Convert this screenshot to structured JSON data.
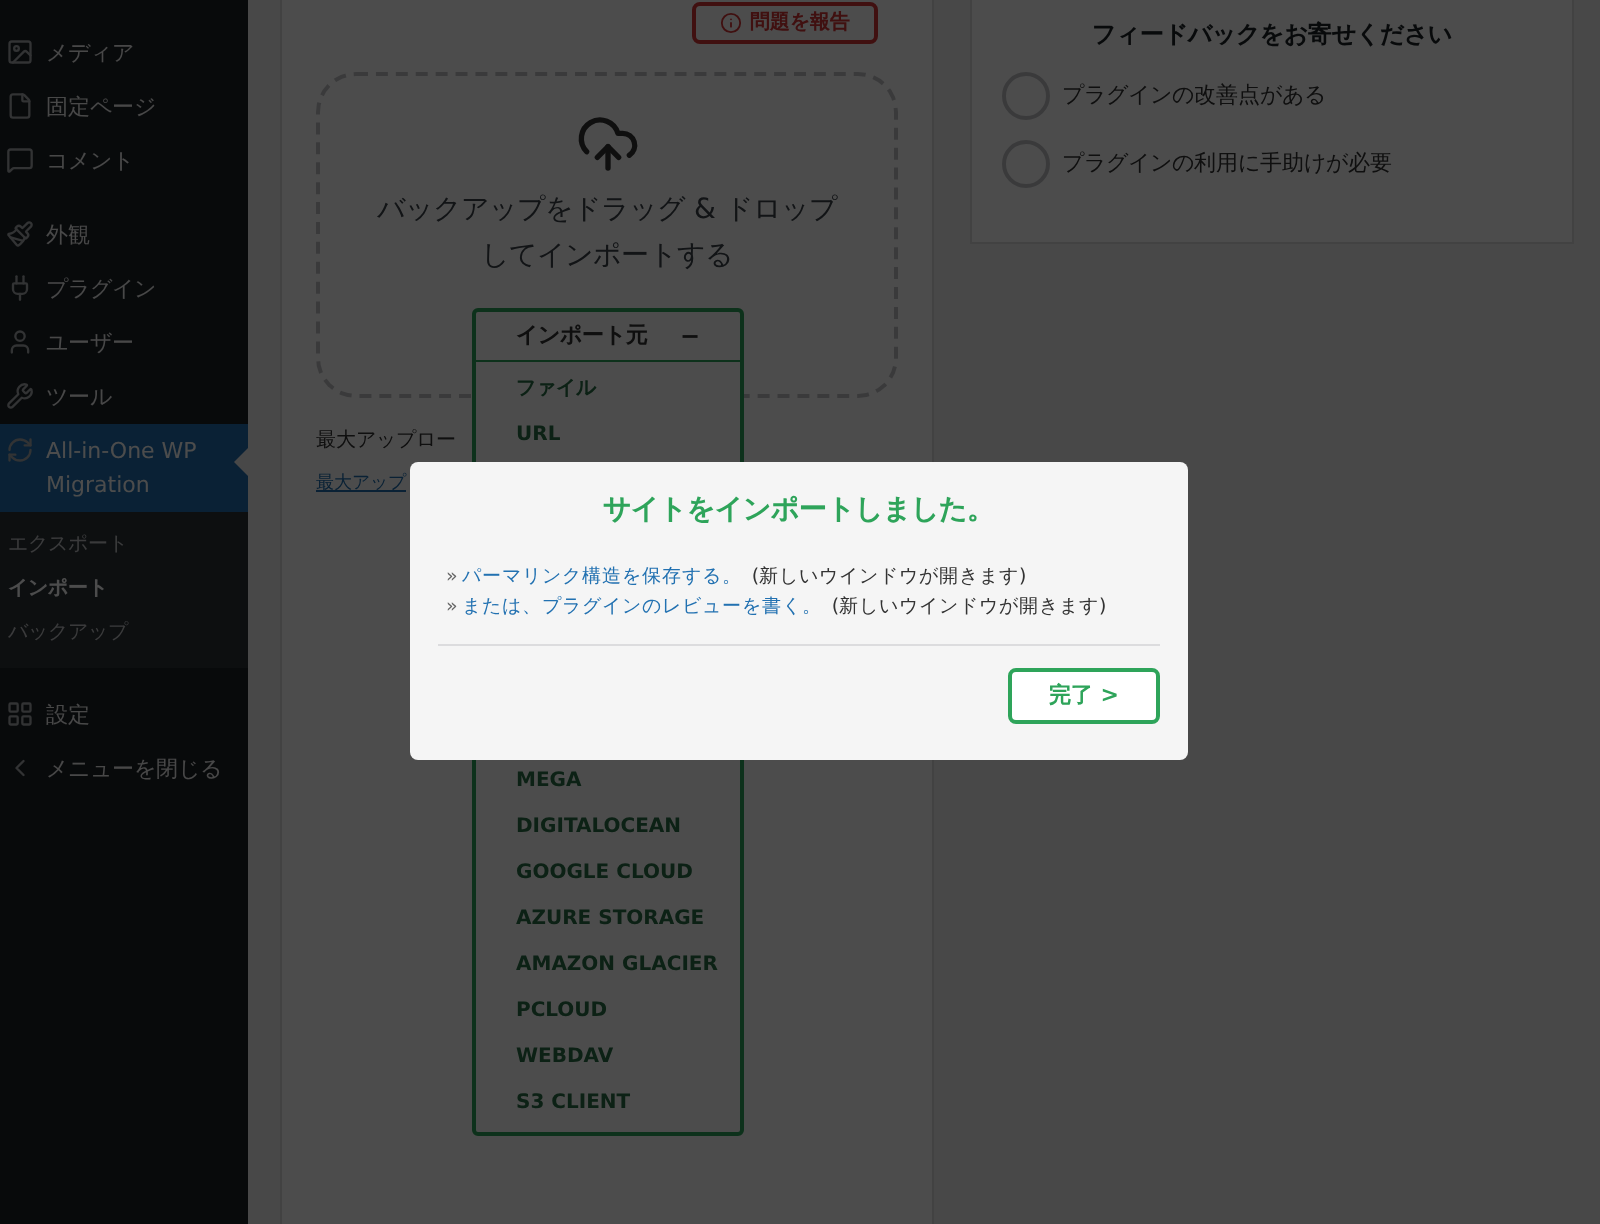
{
  "sidebar": {
    "items": [
      {
        "label": "メディア",
        "selected": false
      },
      {
        "label": "固定ページ",
        "selected": false
      },
      {
        "label": "コメント",
        "selected": false
      },
      {
        "label": "外観",
        "selected": false
      },
      {
        "label": "プラグイン",
        "selected": false
      },
      {
        "label": "ユーザー",
        "selected": false
      },
      {
        "label": "ツール",
        "selected": false
      },
      {
        "label": "All-in-One WP Migration",
        "selected": true,
        "children": [
          {
            "label": "エクスポート",
            "selected": false
          },
          {
            "label": "インポート",
            "selected": true
          },
          {
            "label": "バックアップ",
            "selected": false
          }
        ]
      },
      {
        "label": "設定",
        "selected": false
      },
      {
        "label": "メニューを閉じる",
        "selected": false
      }
    ]
  },
  "report_button": "問題を報告",
  "dropzone": {
    "text": "バックアップをドラッグ & ドロップしてインポートする"
  },
  "import_menu": {
    "title": "インポート元",
    "toggle": "−",
    "items": [
      "ファイル",
      "URL",
      "MEGA",
      "DIGITALOCEAN",
      "GOOGLE CLOUD",
      "AZURE STORAGE",
      "AMAZON GLACIER",
      "PCLOUD",
      "WEBDAV",
      "S3 CLIENT"
    ]
  },
  "max_upload_text": "最大アップロー",
  "max_upload_link": "最大アップ",
  "feedback": {
    "title": "フィードバックをお寄せください",
    "options": [
      {
        "label": "プラグインの改善点がある",
        "checked": false
      },
      {
        "label": "プラグインの利用に手助けが必要",
        "checked": false
      }
    ]
  },
  "modal": {
    "title": "サイトをインポートしました。",
    "links": [
      {
        "marker": "»",
        "link": "パーマリンク構造を保存する。",
        "note": "(新しいウインドウが開きます)"
      },
      {
        "marker": "»",
        "link": "または、プラグインのレビューを書く。",
        "note": "(新しいウインドウが開きます)"
      }
    ],
    "button": "完了 >"
  }
}
